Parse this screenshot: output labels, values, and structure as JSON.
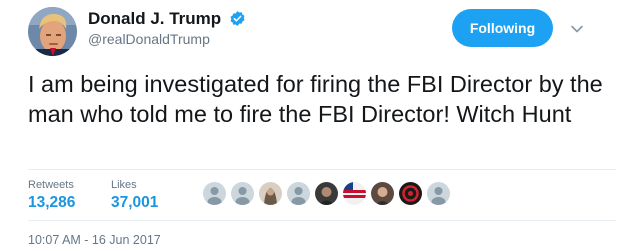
{
  "author": {
    "display_name": "Donald J. Trump",
    "handle": "@realDonaldTrump",
    "verified": true
  },
  "follow_button": {
    "label": "Following"
  },
  "tweet": {
    "text": "I am being investigated for firing the FBI Director by the man who told me to fire the FBI Director! Witch Hunt"
  },
  "stats": {
    "retweets_label": "Retweets",
    "retweets_value": "13,286",
    "likes_label": "Likes",
    "likes_value": "37,001"
  },
  "timestamp": "10:07 AM - 16 Jun 2017",
  "colors": {
    "accent": "#1da1f2",
    "stat_value": "#1b95e0",
    "muted": "#657786",
    "text": "#14171a",
    "divider": "#e6ecf0"
  },
  "liker_avatars": [
    "default-egg",
    "default-egg",
    "photo",
    "default-egg",
    "photo",
    "photo",
    "photo",
    "photo",
    "default-egg"
  ]
}
